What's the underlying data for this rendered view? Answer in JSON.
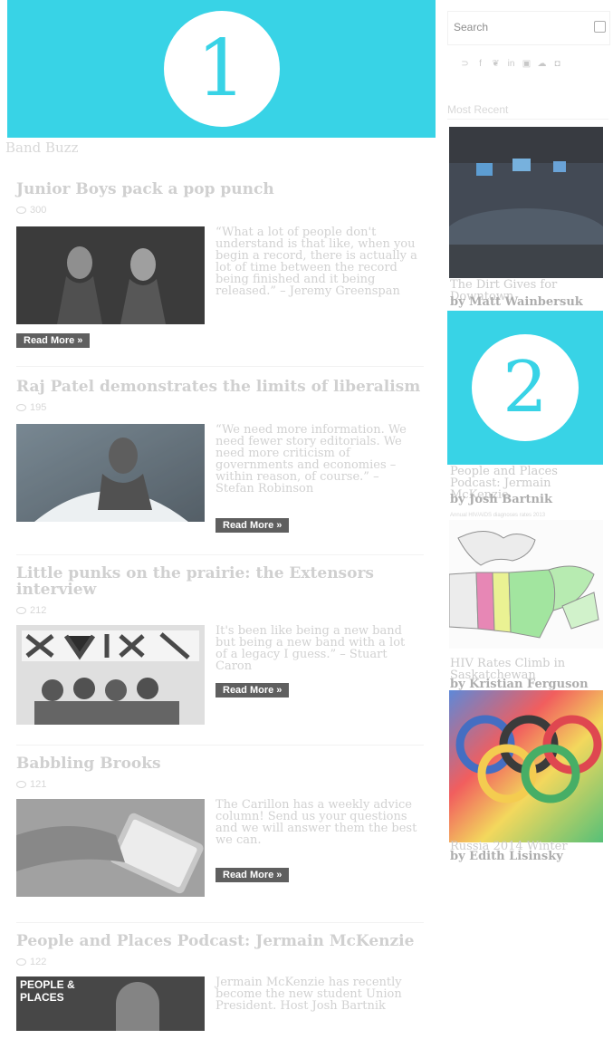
{
  "section_label": "Band Buzz",
  "articles": [
    {
      "title": "Junior Boys pack a pop punch",
      "views": "300",
      "excerpt": "“What a lot of people don't understand is that like, when you begin a record, there is actually a lot of time between the record being finished and it being released.” – Jeremy Greenspan",
      "read_more": "Read More »"
    },
    {
      "title": "Raj Patel demonstrates the limits of liberalism",
      "views": "195",
      "excerpt": "“We need more information. We need fewer story editorials. We need more criticism of governments and economies – within reason, of course.” – Stefan Robinson",
      "read_more": "Read More »"
    },
    {
      "title": "Little punks on the prairie: the Extensors interview",
      "views": "212",
      "excerpt": "It's been like being a new band but being a new band with a lot of a legacy I guess.” – Stuart Caron",
      "read_more": "Read More »"
    },
    {
      "title": "Babbling Brooks",
      "views": "121",
      "excerpt": "The Carillon has a weekly advice column! Send us your questions and we will answer them the best we can.",
      "read_more": "Read More »"
    },
    {
      "title": "People and Places Podcast: Jermain McKenzie",
      "views": "122",
      "excerpt": "Jermain McKenzie has recently become the new student Union President. Host Josh Bartnik"
    }
  ],
  "thumb_texts": {
    "people_places": "PEOPLE & PLACES"
  },
  "sidebar": {
    "search_placeholder": "Search",
    "socials": [
      "rss",
      "f",
      "twitter",
      "in",
      "youtube",
      "soundcloud",
      "instagram"
    ],
    "heading": "Most Recent",
    "items": [
      {
        "title": "The Dirt Gives for Downtown",
        "author": "by Matt Wainbersuk"
      },
      {
        "title": "People and Places Podcast: Jermain McKenzie",
        "author": "by Josh Bartnik"
      },
      {
        "title": "HIV Rates Climb in Saskatchewan",
        "author": "by Kristian Ferguson"
      },
      {
        "title": "Russia 2014 Winter",
        "author": "by Edith Lisinsky"
      }
    ],
    "map_caption": "Annual HIV/AIDS diagnoses rates 2013"
  },
  "overlays": [
    "1",
    "2"
  ],
  "colors": {
    "overlay": "#38d3e6"
  }
}
